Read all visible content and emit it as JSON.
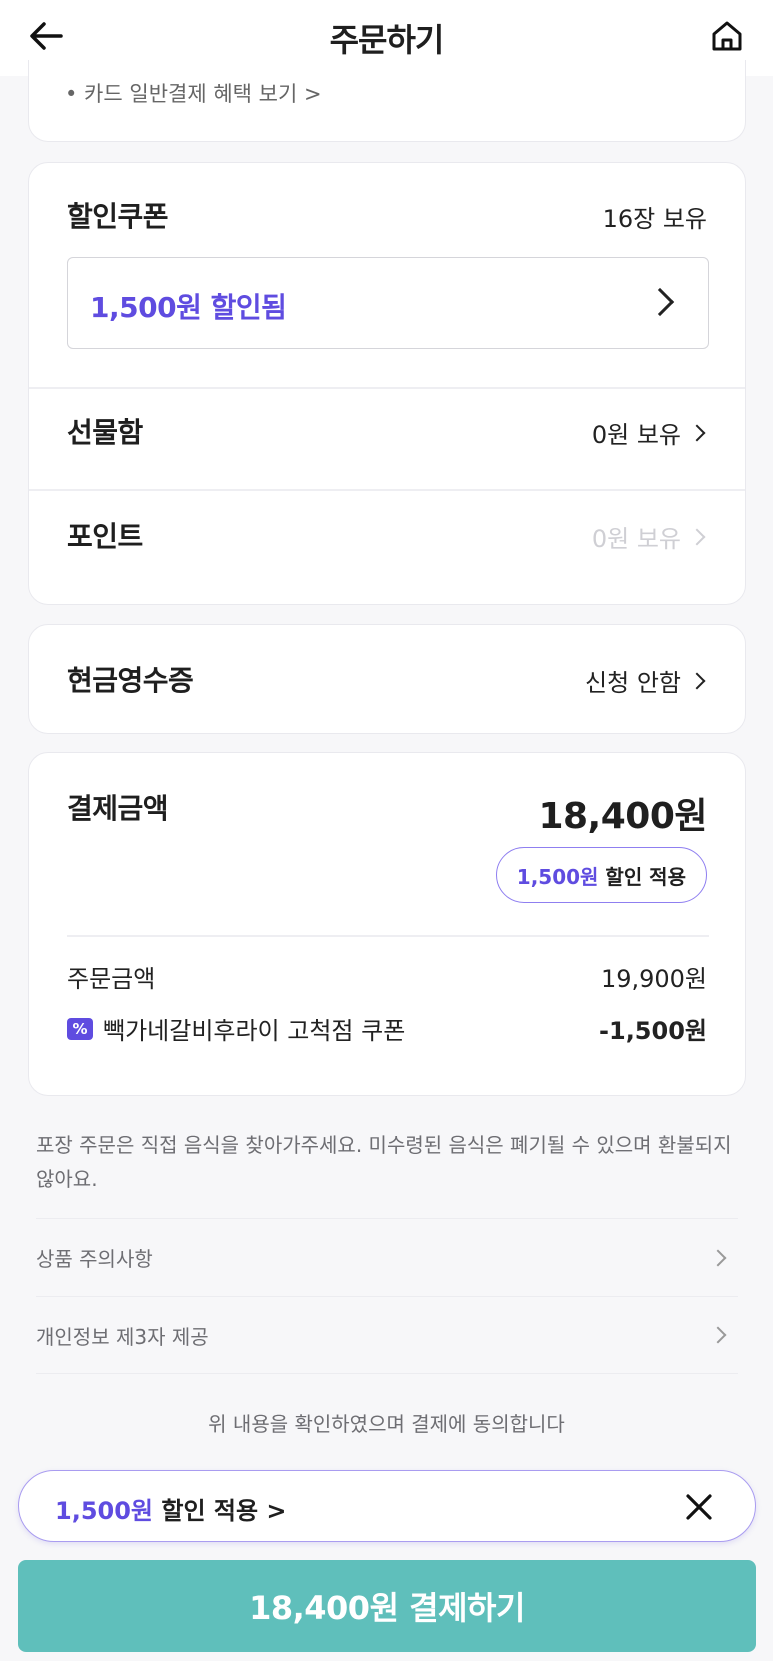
{
  "header": {
    "title": "주문하기"
  },
  "card_benefit": {
    "link": "• 카드 일반결제 혜택 보기 >"
  },
  "coupon": {
    "title": "할인쿠폰",
    "owned": "16장 보유",
    "applied": "1,500원 할인됨"
  },
  "giftbox": {
    "title": "선물함",
    "value": "0원 보유"
  },
  "points": {
    "title": "포인트",
    "value": "0원 보유"
  },
  "receipt": {
    "title": "현금영수증",
    "value": "신청 안함"
  },
  "payment": {
    "title": "결제금액",
    "total": "18,400원",
    "discount_amount": "1,500원",
    "discount_label": "할인 적용",
    "order_label": "주문금액",
    "order_value": "19,900원",
    "coupon_icon": "%",
    "coupon_label": "빽가네갈비후라이 고척점 쿠폰",
    "coupon_value": "-1,500원"
  },
  "notice": "포장 주문은 직접 음식을 찾아가주세요. 미수령된 음식은 폐기될 수 있으며 환불되지 않아요.",
  "links": [
    {
      "label": "상품 주의사항"
    },
    {
      "label": "개인정보 제3자 제공"
    }
  ],
  "agree_text": "위 내용을 확인하였으며 결제에 동의합니다",
  "discount_bar": {
    "amount": "1,500원",
    "label": "할인 적용 >"
  },
  "pay_button": "18,400원 결제하기",
  "colors": {
    "accent_purple": "#5f4ce0",
    "pay_button": "#5fbfbb"
  },
  "icons": [
    "back-arrow-icon",
    "home-icon",
    "chevron-right-icon",
    "coupon-percent-icon",
    "close-icon"
  ]
}
